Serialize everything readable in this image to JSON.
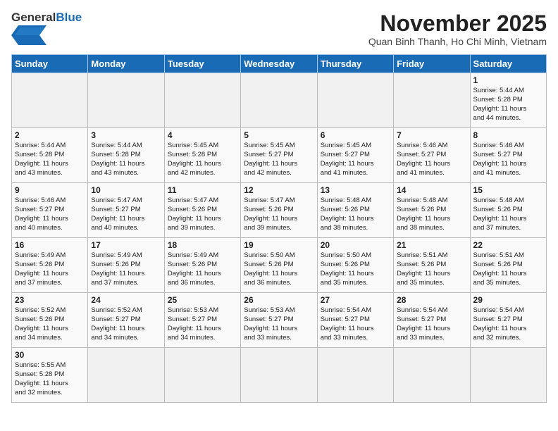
{
  "header": {
    "logo_general": "General",
    "logo_blue": "Blue",
    "month_title": "November 2025",
    "location": "Quan Binh Thanh, Ho Chi Minh, Vietnam"
  },
  "weekdays": [
    "Sunday",
    "Monday",
    "Tuesday",
    "Wednesday",
    "Thursday",
    "Friday",
    "Saturday"
  ],
  "weeks": [
    [
      {
        "day": "",
        "info": ""
      },
      {
        "day": "",
        "info": ""
      },
      {
        "day": "",
        "info": ""
      },
      {
        "day": "",
        "info": ""
      },
      {
        "day": "",
        "info": ""
      },
      {
        "day": "",
        "info": ""
      },
      {
        "day": "1",
        "info": "Sunrise: 5:44 AM\nSunset: 5:28 PM\nDaylight: 11 hours\nand 44 minutes."
      }
    ],
    [
      {
        "day": "2",
        "info": "Sunrise: 5:44 AM\nSunset: 5:28 PM\nDaylight: 11 hours\nand 43 minutes."
      },
      {
        "day": "3",
        "info": "Sunrise: 5:44 AM\nSunset: 5:28 PM\nDaylight: 11 hours\nand 43 minutes."
      },
      {
        "day": "4",
        "info": "Sunrise: 5:45 AM\nSunset: 5:28 PM\nDaylight: 11 hours\nand 42 minutes."
      },
      {
        "day": "5",
        "info": "Sunrise: 5:45 AM\nSunset: 5:27 PM\nDaylight: 11 hours\nand 42 minutes."
      },
      {
        "day": "6",
        "info": "Sunrise: 5:45 AM\nSunset: 5:27 PM\nDaylight: 11 hours\nand 41 minutes."
      },
      {
        "day": "7",
        "info": "Sunrise: 5:46 AM\nSunset: 5:27 PM\nDaylight: 11 hours\nand 41 minutes."
      },
      {
        "day": "8",
        "info": "Sunrise: 5:46 AM\nSunset: 5:27 PM\nDaylight: 11 hours\nand 41 minutes."
      }
    ],
    [
      {
        "day": "9",
        "info": "Sunrise: 5:46 AM\nSunset: 5:27 PM\nDaylight: 11 hours\nand 40 minutes."
      },
      {
        "day": "10",
        "info": "Sunrise: 5:47 AM\nSunset: 5:27 PM\nDaylight: 11 hours\nand 40 minutes."
      },
      {
        "day": "11",
        "info": "Sunrise: 5:47 AM\nSunset: 5:26 PM\nDaylight: 11 hours\nand 39 minutes."
      },
      {
        "day": "12",
        "info": "Sunrise: 5:47 AM\nSunset: 5:26 PM\nDaylight: 11 hours\nand 39 minutes."
      },
      {
        "day": "13",
        "info": "Sunrise: 5:48 AM\nSunset: 5:26 PM\nDaylight: 11 hours\nand 38 minutes."
      },
      {
        "day": "14",
        "info": "Sunrise: 5:48 AM\nSunset: 5:26 PM\nDaylight: 11 hours\nand 38 minutes."
      },
      {
        "day": "15",
        "info": "Sunrise: 5:48 AM\nSunset: 5:26 PM\nDaylight: 11 hours\nand 37 minutes."
      }
    ],
    [
      {
        "day": "16",
        "info": "Sunrise: 5:49 AM\nSunset: 5:26 PM\nDaylight: 11 hours\nand 37 minutes."
      },
      {
        "day": "17",
        "info": "Sunrise: 5:49 AM\nSunset: 5:26 PM\nDaylight: 11 hours\nand 37 minutes."
      },
      {
        "day": "18",
        "info": "Sunrise: 5:49 AM\nSunset: 5:26 PM\nDaylight: 11 hours\nand 36 minutes."
      },
      {
        "day": "19",
        "info": "Sunrise: 5:50 AM\nSunset: 5:26 PM\nDaylight: 11 hours\nand 36 minutes."
      },
      {
        "day": "20",
        "info": "Sunrise: 5:50 AM\nSunset: 5:26 PM\nDaylight: 11 hours\nand 35 minutes."
      },
      {
        "day": "21",
        "info": "Sunrise: 5:51 AM\nSunset: 5:26 PM\nDaylight: 11 hours\nand 35 minutes."
      },
      {
        "day": "22",
        "info": "Sunrise: 5:51 AM\nSunset: 5:26 PM\nDaylight: 11 hours\nand 35 minutes."
      }
    ],
    [
      {
        "day": "23",
        "info": "Sunrise: 5:52 AM\nSunset: 5:26 PM\nDaylight: 11 hours\nand 34 minutes."
      },
      {
        "day": "24",
        "info": "Sunrise: 5:52 AM\nSunset: 5:27 PM\nDaylight: 11 hours\nand 34 minutes."
      },
      {
        "day": "25",
        "info": "Sunrise: 5:53 AM\nSunset: 5:27 PM\nDaylight: 11 hours\nand 34 minutes."
      },
      {
        "day": "26",
        "info": "Sunrise: 5:53 AM\nSunset: 5:27 PM\nDaylight: 11 hours\nand 33 minutes."
      },
      {
        "day": "27",
        "info": "Sunrise: 5:54 AM\nSunset: 5:27 PM\nDaylight: 11 hours\nand 33 minutes."
      },
      {
        "day": "28",
        "info": "Sunrise: 5:54 AM\nSunset: 5:27 PM\nDaylight: 11 hours\nand 33 minutes."
      },
      {
        "day": "29",
        "info": "Sunrise: 5:54 AM\nSunset: 5:27 PM\nDaylight: 11 hours\nand 32 minutes."
      }
    ],
    [
      {
        "day": "30",
        "info": "Sunrise: 5:55 AM\nSunset: 5:28 PM\nDaylight: 11 hours\nand 32 minutes."
      },
      {
        "day": "",
        "info": ""
      },
      {
        "day": "",
        "info": ""
      },
      {
        "day": "",
        "info": ""
      },
      {
        "day": "",
        "info": ""
      },
      {
        "day": "",
        "info": ""
      },
      {
        "day": "",
        "info": ""
      }
    ]
  ]
}
